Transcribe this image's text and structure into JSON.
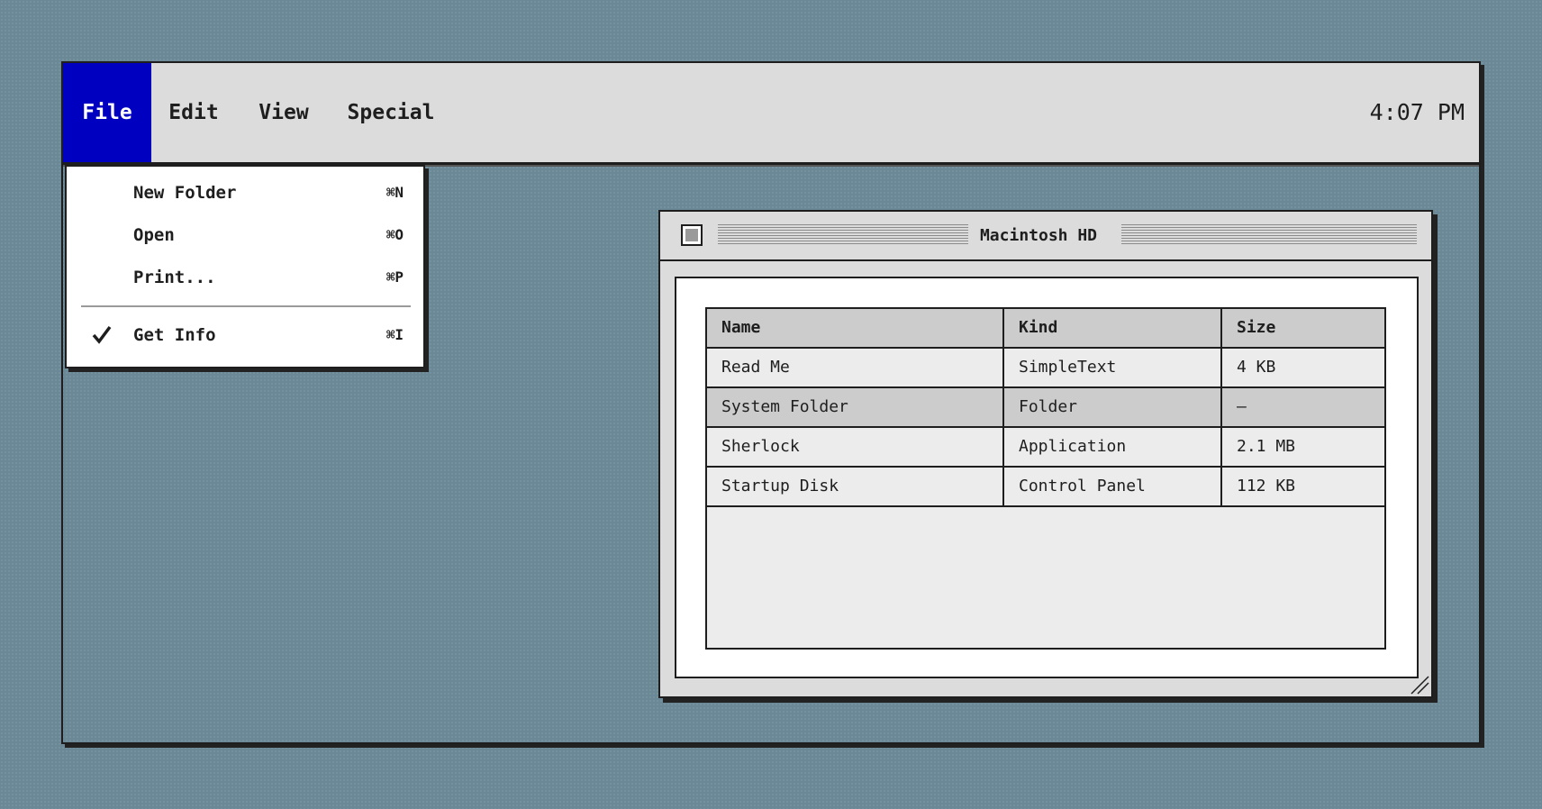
{
  "menubar": {
    "items": [
      {
        "label": "File",
        "active": true
      },
      {
        "label": "Edit"
      },
      {
        "label": "View"
      },
      {
        "label": "Special"
      }
    ],
    "clock": "4:07 PM"
  },
  "file_menu": {
    "items": [
      {
        "label": "New Folder",
        "shortcut": "⌘N",
        "checked": false
      },
      {
        "label": "Open",
        "shortcut": "⌘O",
        "checked": false
      },
      {
        "label": "Print...",
        "shortcut": "⌘P",
        "checked": false
      },
      {
        "label": "Get Info",
        "shortcut": "⌘I",
        "checked": true
      }
    ]
  },
  "window": {
    "title": "Macintosh HD",
    "columns": [
      "Name",
      "Kind",
      "Size"
    ],
    "rows": [
      {
        "name": "Read Me",
        "kind": "SimpleText",
        "size": "4 KB",
        "selected": false
      },
      {
        "name": "System Folder",
        "kind": "Folder",
        "size": "–",
        "selected": true
      },
      {
        "name": "Sherlock",
        "kind": "Application",
        "size": "2.1 MB",
        "selected": false
      },
      {
        "name": "Startup Disk",
        "kind": "Control Panel",
        "size": "112 KB",
        "selected": false
      }
    ]
  },
  "colors": {
    "desktop": "#6a8896",
    "menu_highlight": "#0000c0",
    "chrome": "#dcdcdc"
  }
}
